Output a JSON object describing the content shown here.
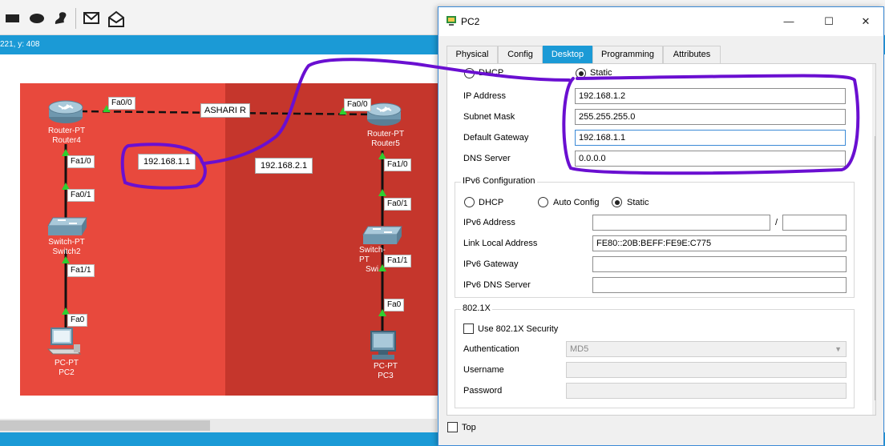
{
  "workspace": {
    "coord_text": "221, y: 408",
    "toolbar_icons": [
      "rectangle-tool-icon",
      "ellipse-tool-icon",
      "freeform-tool-icon",
      "add-pdu-icon",
      "add-complex-pdu-icon"
    ]
  },
  "topology": {
    "router4": {
      "type": "Router-PT",
      "name": "Router4"
    },
    "router5": {
      "type": "Router-PT",
      "name": "Router5"
    },
    "switch2": {
      "type": "Switch-PT",
      "name": "Switch2"
    },
    "switch_right": {
      "type": "Switch-PT",
      "name": "Swi"
    },
    "pc2": {
      "type": "PC-PT",
      "name": "PC2"
    },
    "pc3": {
      "type": "PC-PT",
      "name": "PC3"
    },
    "link_label": "ASHARI R",
    "ports": {
      "r4_fa00": "Fa0/0",
      "r5_fa00": "Fa0/0",
      "r4_fa10": "Fa1/0",
      "sw2_fa01": "Fa0/1",
      "sw2_fa11": "Fa1/1",
      "pc2_fa0": "Fa0",
      "r5_fa10": "Fa1/0",
      "swr_fa01": "Fa0/1",
      "swr_fa11": "Fa1/1",
      "pc3_fa0": "Fa0"
    },
    "net_left": "192.168.1.1",
    "net_right": "192.168.2.1"
  },
  "dialog": {
    "title": "PC2",
    "tabs": [
      "Physical",
      "Config",
      "Desktop",
      "Programming",
      "Attributes"
    ],
    "active_tab": "Desktop",
    "ipv4": {
      "dhcp_label": "DHCP",
      "static_label": "Static",
      "mode": "Static",
      "ip_label": "IP Address",
      "ip_value": "192.168.1.2",
      "mask_label": "Subnet Mask",
      "mask_value": "255.255.255.0",
      "gateway_label": "Default Gateway",
      "gateway_value": "192.168.1.1",
      "dns_label": "DNS Server",
      "dns_value": "0.0.0.0"
    },
    "ipv6": {
      "group_title": "IPv6 Configuration",
      "dhcp_label": "DHCP",
      "auto_label": "Auto Config",
      "static_label": "Static",
      "mode": "Static",
      "address_label": "IPv6 Address",
      "address_value": "",
      "prefix_sep": "/",
      "prefix_value": "",
      "link_local_label": "Link Local Address",
      "link_local_value": "FE80::20B:BEFF:FE9E:C775",
      "gateway_label": "IPv6 Gateway",
      "gateway_value": "",
      "dns_label": "IPv6 DNS Server",
      "dns_value": ""
    },
    "dot1x": {
      "group_title": "802.1X",
      "use_label": "Use 802.1X Security",
      "use_checked": false,
      "auth_label": "Authentication",
      "auth_value": "MD5",
      "username_label": "Username",
      "username_value": "",
      "password_label": "Password",
      "password_value": ""
    },
    "top_label": "Top",
    "top_checked": false
  },
  "colors": {
    "accent_blue": "#1b9ad6",
    "zone_left": "#e8493d",
    "zone_right": "#c5362c",
    "annotation": "#6a0fd1",
    "link_green": "#2fcf2f"
  }
}
